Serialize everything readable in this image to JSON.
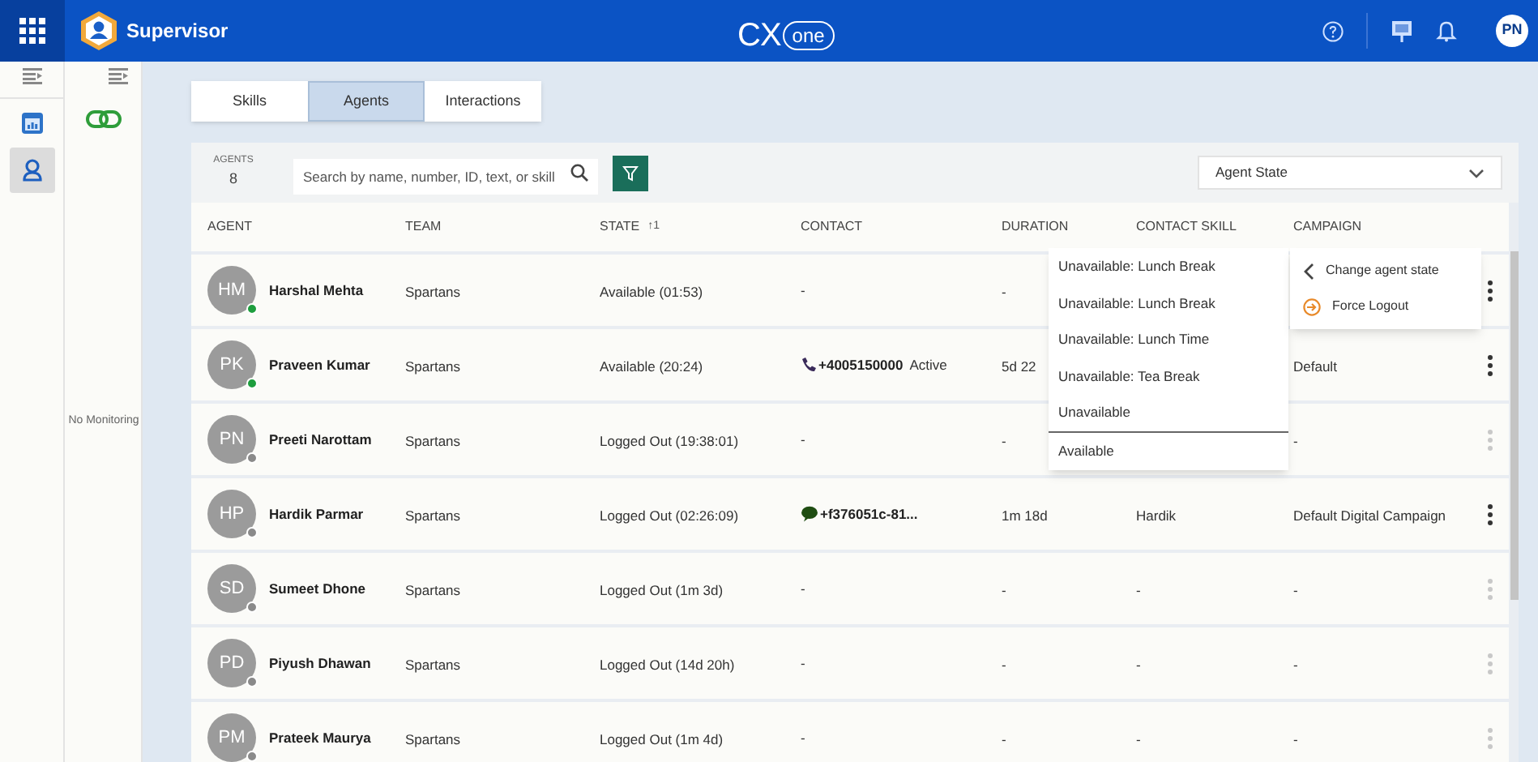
{
  "app": {
    "title": "Supervisor",
    "logo_text": "CX",
    "logo_cloud_text": "one",
    "user_initials": "PN"
  },
  "side_panel": {
    "message": "No Monitoring"
  },
  "tabs": [
    {
      "label": "Skills",
      "selected": false
    },
    {
      "label": "Agents",
      "selected": true
    },
    {
      "label": "Interactions",
      "selected": false
    }
  ],
  "toolbar": {
    "count_label": "AGENTS",
    "count": "8",
    "search": {
      "placeholder": "Search by name, number, ID, text, or skill"
    },
    "filter_dropdown": {
      "value": "Agent State"
    }
  },
  "table": {
    "columns": [
      "AGENT",
      "TEAM",
      "STATE",
      "CONTACT",
      "DURATION",
      "CONTACT SKILL",
      "CAMPAIGN"
    ],
    "sort_mark": "↑1",
    "rows": [
      {
        "initials": "HM",
        "name": "Harshal Mehta",
        "color": "#1e9e3e",
        "team": "Spartans",
        "state": "Available (01:53)",
        "contact": {
          "kind": "none",
          "text": "-"
        },
        "duration": "-",
        "menu_enabled": true
      },
      {
        "initials": "PK",
        "name": "Praveen Kumar",
        "color": "#1e9e3e",
        "team": "Spartans",
        "state": "Available (20:24)",
        "contact": {
          "kind": "phone",
          "text": "+4005150000",
          "status": "Active"
        },
        "duration": "5d 22",
        "campaign": "Default",
        "menu_enabled": true
      },
      {
        "initials": "PN",
        "name": "Preeti Narottam",
        "color": "#8a8a8a",
        "team": "Spartans",
        "state": "Logged Out (19:38:01)",
        "contact": {
          "kind": "none",
          "text": "-"
        },
        "duration": "-",
        "campaign": "-",
        "menu_enabled": false
      },
      {
        "initials": "HP",
        "name": "Hardik Parmar",
        "color": "#8a8a8a",
        "team": "Spartans",
        "state": "Logged Out (02:26:09)",
        "contact": {
          "kind": "chat",
          "text": "+f376051c-81..."
        },
        "duration": "1m 18d",
        "skill": "Hardik",
        "campaign": "Default Digital Campaign",
        "menu_enabled": true
      },
      {
        "initials": "SD",
        "name": "Sumeet Dhone",
        "color": "#8a8a8a",
        "team": "Spartans",
        "state": "Logged Out (1m 3d)",
        "contact": {
          "kind": "none",
          "text": "-"
        },
        "duration": "-",
        "skill": "-",
        "campaign": "-",
        "menu_enabled": false
      },
      {
        "initials": "PD",
        "name": "Piyush Dhawan",
        "color": "#8a8a8a",
        "team": "Spartans",
        "state": "Logged Out (14d 20h)",
        "contact": {
          "kind": "none",
          "text": "-"
        },
        "duration": "-",
        "skill": "-",
        "campaign": "-",
        "menu_enabled": false
      },
      {
        "initials": "PM",
        "name": "Prateek Maurya",
        "color": "#8a8a8a",
        "team": "Spartans",
        "state": "Logged Out (1m 4d)",
        "contact": {
          "kind": "none",
          "text": "-"
        },
        "duration": "-",
        "skill": "-",
        "campaign": "-",
        "menu_enabled": false
      }
    ]
  },
  "state_menu": {
    "items": [
      "Unavailable: Lunch Break",
      "Unavailable: Lunch Break",
      "Unavailable: Lunch Time",
      "Unavailable: Tea Break",
      "Unavailable"
    ],
    "footer": "Available"
  },
  "context_menu": [
    {
      "kind": "back",
      "label": "Change agent state"
    },
    {
      "kind": "logout",
      "label": "Force Logout"
    }
  ]
}
